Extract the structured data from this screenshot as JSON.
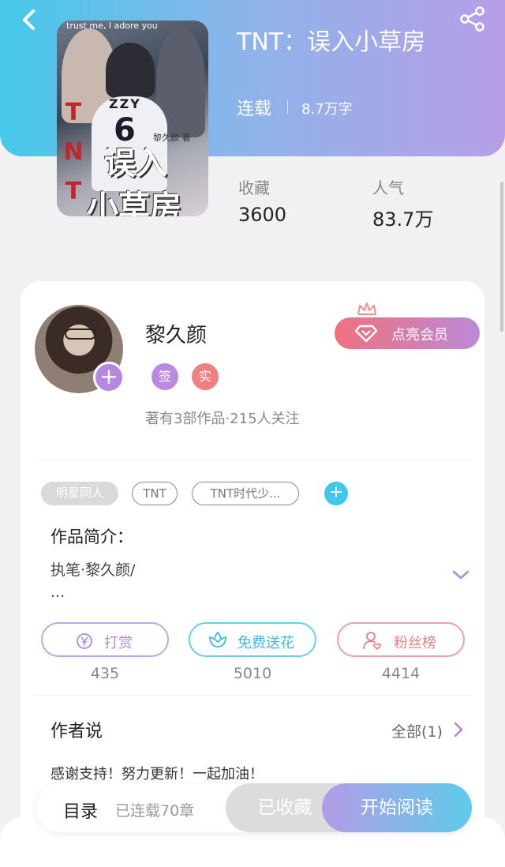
{
  "header": {
    "book_title": "TNT：误入小草房",
    "status": "连载",
    "word_count": "8.7万字"
  },
  "cover": {
    "top_text": "trust me, I adore you",
    "jersey_name": "ZZY",
    "jersey_number": "6",
    "side_letters": [
      "T",
      "N",
      "T"
    ],
    "title_line1": "误入",
    "title_line2": "小草房",
    "author_mark": "黎久颜 著"
  },
  "stats": {
    "favorites_label": "收藏",
    "favorites_value": "3600",
    "popularity_label": "人气",
    "popularity_value": "83.7万"
  },
  "author": {
    "name": "黎久颜",
    "badge_signed": "签",
    "badge_verified": "实",
    "meta": "著有3部作品·215人关注",
    "vip_button": "点亮会员",
    "follow_symbol": "+"
  },
  "tags": [
    "明星同人",
    "TNT",
    "TNT时代少..."
  ],
  "tag_add_symbol": "+",
  "intro": {
    "title": "作品简介：",
    "line1": "执笔·黎久颜/",
    "line2": "..."
  },
  "actions": [
    {
      "label": "打赏",
      "count": "435",
      "icon": "yen-coin-icon"
    },
    {
      "label": "免费送花",
      "count": "5010",
      "icon": "flower-icon"
    },
    {
      "label": "粉丝榜",
      "count": "4414",
      "icon": "fan-user-icon"
    }
  ],
  "author_says": {
    "title": "作者说",
    "all_link": "全部(1)",
    "message": "感谢支持！努力更新！一起加油！"
  },
  "bottom_bar": {
    "toc": "目录",
    "chapters": "已连载70章",
    "collected": "已收藏",
    "start_reading": "开始阅读"
  },
  "colors": {
    "header_gradient_start": "#45c9ea",
    "header_gradient_end": "#b79ee8",
    "purple_accent": "#b786e0",
    "cyan_accent": "#3fc8ec",
    "pink_accent": "#f0707f"
  }
}
